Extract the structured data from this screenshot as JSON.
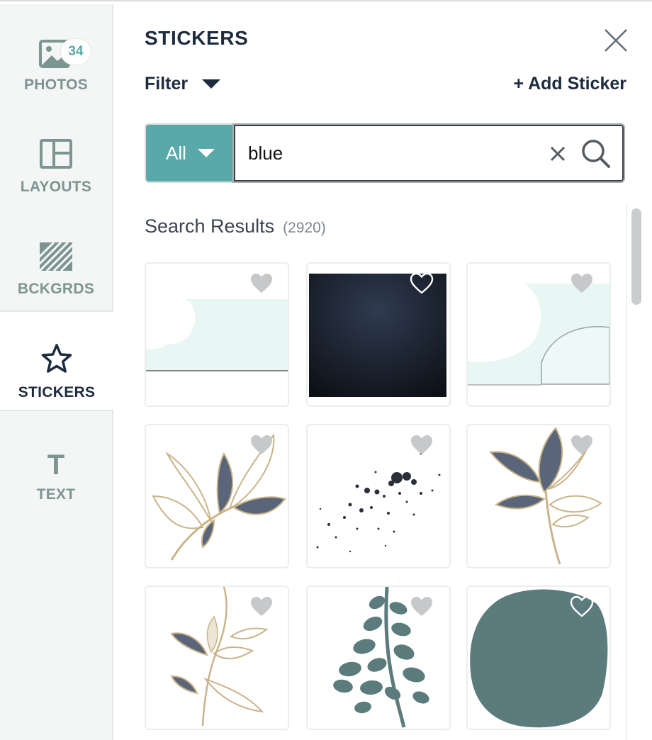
{
  "sidebar": {
    "items": [
      {
        "label": "PHOTOS",
        "icon": "photo-icon",
        "badge": "34"
      },
      {
        "label": "LAYOUTS",
        "icon": "layout-icon"
      },
      {
        "label": "BCKGRDS",
        "icon": "background-icon"
      },
      {
        "label": "STICKERS",
        "icon": "star-icon",
        "active": true
      },
      {
        "label": "TEXT",
        "icon": "text-icon",
        "glyph": "T"
      }
    ]
  },
  "panel": {
    "title": "STICKERS",
    "close_icon": "close-icon",
    "filter_label": "Filter",
    "add_sticker_label": "+ Add Sticker"
  },
  "search": {
    "category": "All",
    "query": "blue",
    "clear_icon": "clear-icon",
    "search_icon": "search-icon"
  },
  "results": {
    "heading": "Search Results",
    "count": "(2920)",
    "stickers": [
      {
        "name": "torn-paper-mint-strip",
        "favorite": false
      },
      {
        "name": "dark-navy-gradient-square",
        "favorite": false
      },
      {
        "name": "torn-paper-mint-layered",
        "favorite": false
      },
      {
        "name": "gold-outline-leaf-branch",
        "favorite": false
      },
      {
        "name": "ink-splatter-dots",
        "favorite": false
      },
      {
        "name": "gold-outline-leaf-stem",
        "favorite": false
      },
      {
        "name": "gold-outline-flower-sprig",
        "favorite": false
      },
      {
        "name": "teal-eucalyptus-sprig",
        "favorite": false
      },
      {
        "name": "teal-organic-blob",
        "favorite": false
      }
    ]
  },
  "colors": {
    "accent": "#5aa9aa",
    "navy": "#1d2b3e",
    "muted": "#7d9591",
    "leaf": "#5b6579",
    "gold": "#c9b48a",
    "mint": "#e8f6f4",
    "teal": "#5b7b7d"
  }
}
